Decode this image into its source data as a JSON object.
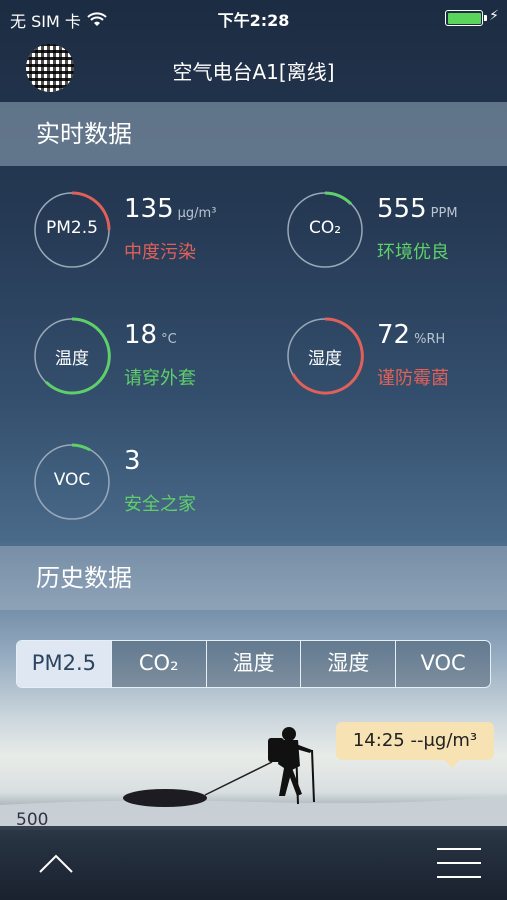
{
  "status_bar": {
    "carrier": "无 SIM 卡",
    "time": "下午2:28",
    "battery_color": "#5ad45a"
  },
  "nav": {
    "title": "空气电台A1[离线]"
  },
  "realtime": {
    "header": "实时数据",
    "metrics": [
      {
        "label": "PM2.5",
        "value": "135",
        "unit": "μg/m³",
        "status": "中度污染",
        "status_color": "#e0605a",
        "arc_color": "#e0605a"
      },
      {
        "label": "CO₂",
        "value": "555",
        "unit": "PPM",
        "status": "环境优良",
        "status_color": "#5fcf6a",
        "arc_color": "#5fcf6a"
      },
      {
        "label": "温度",
        "value": "18",
        "unit": "°C",
        "status": "请穿外套",
        "status_color": "#5fcf6a",
        "arc_color": "#5fcf6a"
      },
      {
        "label": "湿度",
        "value": "72",
        "unit": "%RH",
        "status": "谨防霉菌",
        "status_color": "#e0605a",
        "arc_color": "#e0605a"
      },
      {
        "label": "VOC",
        "value": "3",
        "unit": "",
        "status": "安全之家",
        "status_color": "#5fcf6a",
        "arc_color": "#5fcf6a"
      }
    ]
  },
  "history": {
    "header": "历史数据",
    "tabs": [
      "PM2.5",
      "CO₂",
      "温度",
      "湿度",
      "VOC"
    ],
    "active_tab": "PM2.5",
    "tooltip": "14:25 --μg/m³",
    "axis_label": "500"
  },
  "bottom_bar": {
    "left_icon": "chevron-up-icon",
    "right_icon": "menu-icon"
  }
}
